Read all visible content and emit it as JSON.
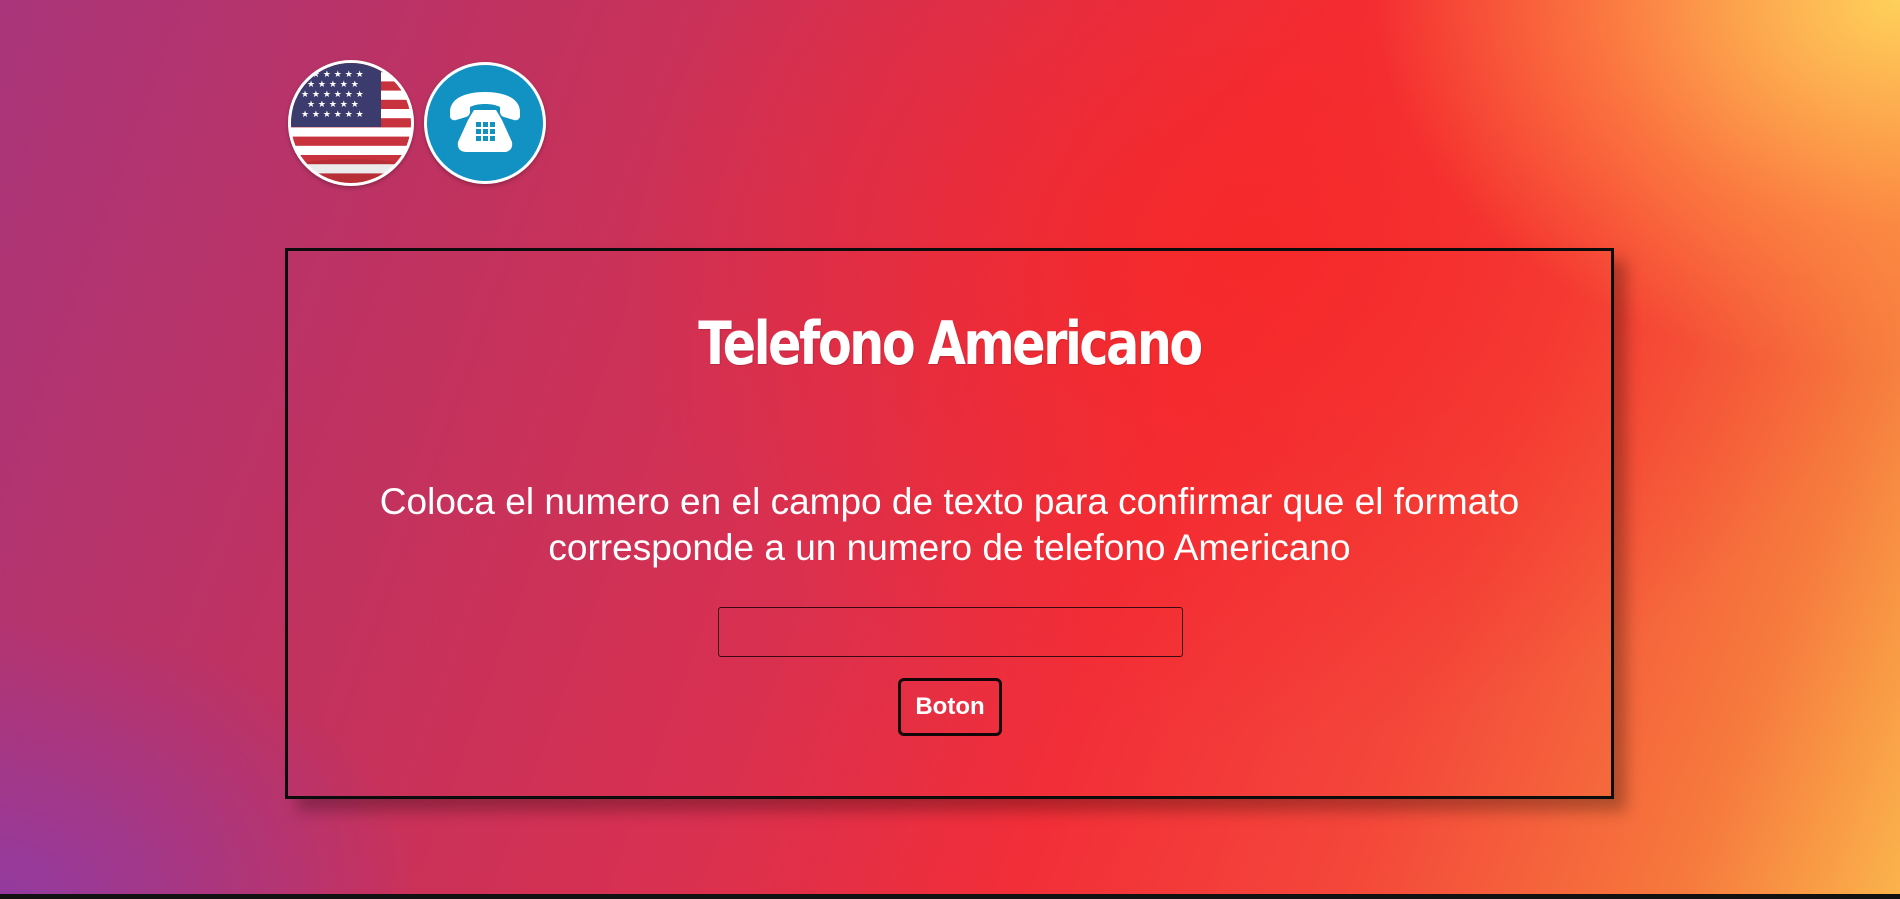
{
  "header": {
    "flag_icon": "us-flag-icon",
    "phone_icon": "telephone-icon"
  },
  "card": {
    "title": "Telefono Americano",
    "description": "Coloca el numero en el campo de texto para confirmar que el formato corresponde a un numero de telefono Americano",
    "input_value": "",
    "input_placeholder": "",
    "button_label": "Boton"
  },
  "colors": {
    "phone_icon_bg": "#1192c2",
    "card_border": "#0c0c0c",
    "text": "#ffffff"
  }
}
